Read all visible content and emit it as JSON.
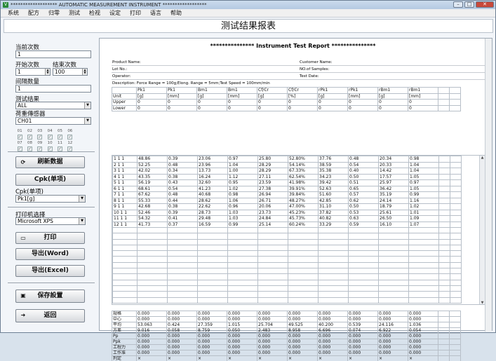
{
  "window": {
    "title": "******************* AUTOMATIC MEASUREMENT INSTRUMENT ******************"
  },
  "menu": [
    "系统",
    "配方",
    "归零",
    "测试",
    "检视",
    "设定",
    "打印",
    "语言",
    "帮助"
  ],
  "header": {
    "title": "测试结果报表"
  },
  "left": {
    "current_count_label": "当前次数",
    "current_count_value": "1",
    "start_count_label": "开始次数",
    "start_count_value": "1",
    "end_count_label": "结束次数",
    "end_count_value": "100",
    "interval_label": "间隔数量",
    "interval_value": "1",
    "result_label": "测试结果",
    "result_value": "ALL",
    "sensor_label": "荷重傳感器",
    "sensor_value": "CH01",
    "channel_numbers": [
      "01",
      "02",
      "03",
      "04",
      "05",
      "06",
      "07",
      "08",
      "09",
      "10",
      "11",
      "12"
    ],
    "refresh_label": "刷新数据",
    "cpk_button_label": "Cpk(单项)",
    "cpk_label": "Cpk(单项)",
    "cpk_value": "Pk1[g]",
    "printer_label": "打印机选择",
    "printer_value": "Microsoft XPS",
    "print_label": "打印",
    "export_word_label": "导出(Word)",
    "export_excel_label": "导出(Excel)",
    "save_label": "保存設置",
    "back_label": "返回"
  },
  "report": {
    "title": "*************** Instrument Test Report ***************",
    "product_name": "Product Name:",
    "customer_name": "Customer Name:",
    "lot_no": "Lot No.:",
    "no_samples": "NO.of Samples:",
    "operator": "Operator:",
    "test_date": "Test Date:",
    "description": "Description:  Force Range = 100g;Elong. Range = 5mm;Test Speed = 100mm/min",
    "columns": [
      "Pk1",
      "Pk1",
      "Bm1",
      "Bm1",
      "Cf/Cr",
      "Cf/Cr",
      "rPk1",
      "rPk1",
      "rBm1",
      "rBm1"
    ],
    "unit_label": "Unit",
    "units": [
      "[g]",
      "[mm]",
      "[g]",
      "[mm]",
      "[g]",
      "[%]",
      "[g]",
      "[mm]",
      "[g]",
      "[mm]"
    ],
    "upper_label": "Upper",
    "lower_label": "Lower",
    "upper": [
      "0",
      "0",
      "0",
      "0",
      "0",
      "0",
      "0",
      "0",
      "0",
      "0"
    ],
    "lower": [
      "0",
      "0",
      "0",
      "0",
      "0",
      "0",
      "0",
      "0",
      "0",
      "0"
    ],
    "rows": [
      [
        "1  1  1",
        "48.86",
        "0.39",
        "23.06",
        "0.97",
        "25.80",
        "52.80%",
        "37.76",
        "0.48",
        "20.34",
        "0.98"
      ],
      [
        "2  1  1",
        "52.25",
        "0.48",
        "23.96",
        "1.04",
        "28.29",
        "54.14%",
        "38.59",
        "0.54",
        "20.33",
        "1.04"
      ],
      [
        "3  1  1",
        "42.02",
        "0.34",
        "13.73",
        "1.00",
        "28.29",
        "67.33%",
        "35.38",
        "0.40",
        "14.42",
        "1.04"
      ],
      [
        "4  1  1",
        "43.35",
        "0.38",
        "16.24",
        "1.12",
        "27.11",
        "62.54%",
        "34.23",
        "0.50",
        "17.57",
        "1.05"
      ],
      [
        "5  1  1",
        "56.19",
        "0.43",
        "32.60",
        "0.95",
        "23.59",
        "41.98%",
        "39.42",
        "0.51",
        "25.97",
        "0.97"
      ],
      [
        "6  1  1",
        "68.61",
        "0.54",
        "41.23",
        "1.02",
        "27.38",
        "39.91%",
        "52.63",
        "0.65",
        "36.42",
        "1.05"
      ],
      [
        "7  1  1",
        "67.62",
        "0.48",
        "40.68",
        "0.98",
        "26.94",
        "39.84%",
        "51.60",
        "0.57",
        "35.19",
        "0.99"
      ],
      [
        "8  1  1",
        "55.33",
        "0.44",
        "28.62",
        "1.06",
        "26.71",
        "48.27%",
        "42.85",
        "0.62",
        "24.14",
        "1.16"
      ],
      [
        "9  1  1",
        "42.68",
        "0.38",
        "22.62",
        "0.96",
        "20.06",
        "47.00%",
        "31.10",
        "0.50",
        "18.79",
        "1.02"
      ],
      [
        "10  1  1",
        "52.46",
        "0.39",
        "28.73",
        "1.03",
        "23.73",
        "45.23%",
        "37.82",
        "0.53",
        "25.61",
        "1.01"
      ],
      [
        "11  1  1",
        "54.32",
        "0.41",
        "29.48",
        "1.03",
        "24.84",
        "45.73%",
        "40.82",
        "0.63",
        "26.50",
        "1.09"
      ],
      [
        "12  1  1",
        "41.73",
        "0.37",
        "16.59",
        "0.99",
        "25.14",
        "60.24%",
        "33.29",
        "0.59",
        "16.10",
        "1.07"
      ]
    ],
    "stats": [
      [
        "规格",
        "0.000",
        "0.000",
        "0.000",
        "0.000",
        "0.000",
        "0.000",
        "0.000",
        "0.000",
        "0.000",
        "0.000"
      ],
      [
        "中心",
        "0.000",
        "0.000",
        "0.000",
        "0.000",
        "0.000",
        "0.000",
        "0.000",
        "0.000",
        "0.000",
        "0.000"
      ],
      [
        "平均",
        "53.063",
        "0.424",
        "27.359",
        "1.015",
        "25.704",
        "49.525",
        "40.200",
        "0.539",
        "24.116",
        "1.036"
      ],
      [
        "方差",
        "9.016",
        "0.058",
        "8.759",
        "0.050",
        "2.483",
        "8.958",
        "6.696",
        "0.074",
        "6.922",
        "0.054"
      ],
      [
        "Pp",
        "0.000",
        "0.000",
        "0.000",
        "0.000",
        "0.000",
        "0.000",
        "0.000",
        "0.000",
        "0.000",
        "0.000"
      ],
      [
        "Ppk",
        "0.000",
        "0.000",
        "0.000",
        "0.000",
        "0.000",
        "0.000",
        "0.000",
        "0.000",
        "0.000",
        "0.000"
      ],
      [
        "工程力",
        "0.000",
        "0.000",
        "0.000",
        "0.000",
        "0.000",
        "0.000",
        "0.000",
        "0.000",
        "0.000",
        "0.000"
      ],
      [
        "工作准",
        "0.000",
        "0.000",
        "0.000",
        "0.000",
        "0.000",
        "0.000",
        "0.000",
        "0.000",
        "0.000",
        "0.000"
      ],
      [
        "判定",
        "×",
        "×",
        "×",
        "×",
        "×",
        "×",
        "×",
        "×",
        "×",
        "×"
      ]
    ]
  }
}
